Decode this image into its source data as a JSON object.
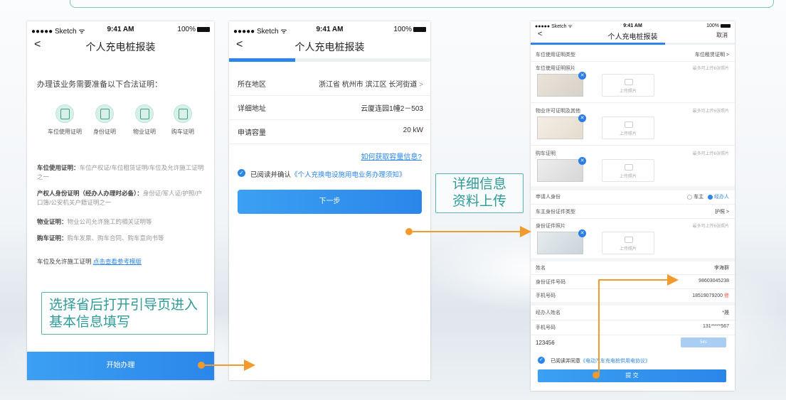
{
  "status": {
    "carrier": "●●●●● Sketch ᯤ",
    "time": "9:41 AM",
    "battery": "100%"
  },
  "screen1": {
    "title": "个人充电桩报装",
    "intro": "办理该业务需要准备以下合法证明：",
    "docs": [
      {
        "label": "车位使用证明",
        "icon": "document-icon"
      },
      {
        "label": "身份证明",
        "icon": "id-card-icon"
      },
      {
        "label": "物业证明",
        "icon": "house-certificate-icon"
      },
      {
        "label": "购车证明",
        "icon": "receipt-icon"
      }
    ],
    "notes": [
      {
        "head": "车位使用证明：",
        "body": "车位产权证/车位租赁证明/车位及允许施工证明之一"
      },
      {
        "head": "产权人身份证明（经办人办理时必备）：",
        "body": "身份证/军人证/护照/户口簿/公安机关户籍证明之一"
      },
      {
        "head": "物业证明：",
        "body": "物业公司允许施工的相关证明等"
      },
      {
        "head": "购车证明：",
        "body": "购车发票、购车合同、购车意向书等"
      }
    ],
    "template_prefix": "车位及允许施工证明 ",
    "template_link": "点击查看参考模版",
    "start_button": "开始办理"
  },
  "screen2": {
    "title": "个人充电桩报装",
    "rows": [
      {
        "label": "所在地区",
        "value": "浙江省 杭州市 滨江区 长河街道"
      },
      {
        "label": "详细地址",
        "value": "云厦连园1幢2－503"
      },
      {
        "label": "申请容量",
        "value": "20 kW"
      }
    ],
    "capacity_link": "如何获取容量信息?",
    "agree_prefix": "已阅读并确认",
    "agree_link": "《个人充换电设施用电业务办理须知》",
    "next_button": "下一步"
  },
  "screen3": {
    "title": "个人充电桩报装",
    "cancel": "取消",
    "rows": {
      "cert_type_label": "车位使用证明类型",
      "cert_type_value": "车位租赁证明",
      "cert_photo_label": "车位使用证明照片",
      "prop_label": "物业许可证明及其他",
      "car_label": "购车证明",
      "max_hint": "最多可上传6张照片",
      "upload": "上传照片",
      "applicant_label": "申请人身份",
      "owner_opt": "车主",
      "agent_opt": "经办人",
      "id_type_label": "车主身份证件类型",
      "id_type_value": "护照",
      "id_photo_label": "身份证件照片",
      "name_label": "姓名",
      "name_value": "李海群",
      "id_no_label": "身份证件号码",
      "id_no_value": "98603045238",
      "phone_label": "手机号码",
      "phone_value": "18519079200",
      "phone_tag": "修",
      "agent_name_label": "经办人姓名",
      "agent_name_value": "*晟",
      "agent_phone_label": "手机号码",
      "agent_phone_value": "131*****567",
      "code_value": "123456",
      "code_button": "54s"
    },
    "agree_prefix": "已阅读并同意",
    "agree_link": "《电动汽车充电桩供用电协议》",
    "submit": "提 交"
  },
  "annotations": {
    "a1": "选择省后打开引导页进入基本信息填写",
    "a2": "详细信息资料上传"
  },
  "colors": {
    "accent": "#2b86ea",
    "arrow": "#f29a2e",
    "annot": "#2e9b98"
  }
}
